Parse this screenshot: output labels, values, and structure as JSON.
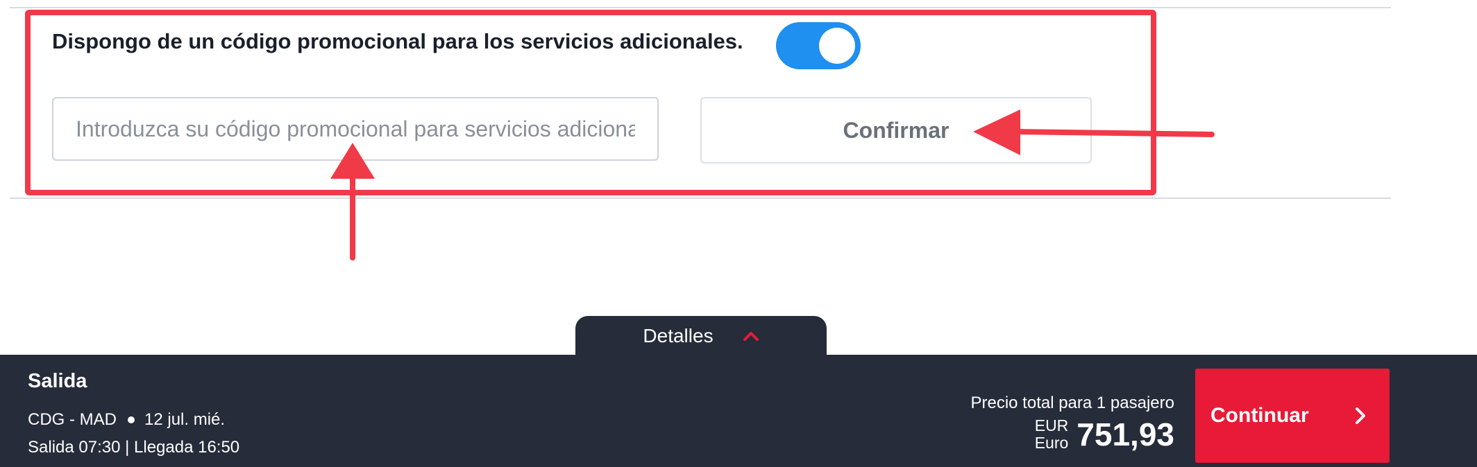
{
  "promo": {
    "label": "Dispongo de un código promocional para los servicios adicionales.",
    "toggle_on": true,
    "input_placeholder": "Introduzca su código promocional para servicios adicionales",
    "input_value": "",
    "confirm_label": "Confirmar"
  },
  "details_tab": {
    "label": "Detalles",
    "icon": "chevron-up-icon"
  },
  "footer": {
    "title": "Salida",
    "route": "CDG - MAD",
    "date": "12 jul. mié.",
    "times": "Salida 07:30 | Llegada 16:50",
    "price_caption": "Precio total para 1 pasajero",
    "currency_code": "EUR",
    "currency_name": "Euro",
    "price": "751,93",
    "continue_label": "Continuar",
    "continue_icon": "chevron-right-icon"
  },
  "colors": {
    "annotation_red": "#f03a48",
    "toggle_blue": "#1f8ff0",
    "footer_bg": "#262c3a",
    "continue_red": "#e81a37"
  }
}
